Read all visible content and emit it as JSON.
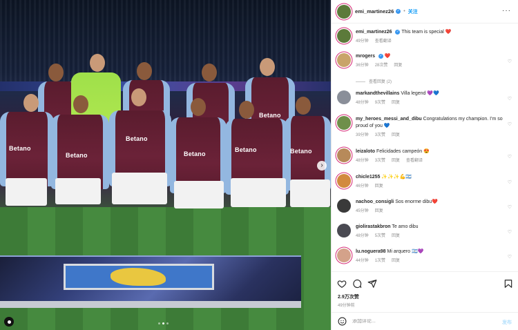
{
  "post": {
    "author": "emi_martinez26",
    "follow_label": "关注",
    "caption": "This team is special",
    "caption_emoji": "❤️",
    "caption_time": "49分钟",
    "caption_action": "查看翻译",
    "slide_count": 3,
    "active_slide": 2,
    "likes": "2.9万次赞",
    "time_ago": "49分钟前",
    "comment_placeholder": "添加评论...",
    "post_label": "发布"
  },
  "photo": {
    "sponsor": "Betano"
  },
  "comments": [
    {
      "user": "mrogers",
      "text": "",
      "emoji": "❤️",
      "verified": true,
      "time": "36分钟",
      "likes": "28次赞",
      "reply": "回复",
      "avatar_color": "#c9a46a",
      "story_ring": true
    },
    {
      "user": "markandthevillains",
      "text": "Villa legend",
      "emoji": "💜💙",
      "verified": false,
      "time": "48分钟",
      "likes": "9次赞",
      "reply": "回复",
      "avatar_color": "#8a8f99",
      "story_ring": false
    },
    {
      "user": "my_heroes_messi_and_dibu",
      "text": "Congratulations my champion. I'm so proud of you",
      "emoji": "💙",
      "verified": false,
      "time": "39分钟",
      "likes": "3次赞",
      "reply": "回复",
      "avatar_color": "#6f8f4a",
      "story_ring": true
    },
    {
      "user": "leizaloto",
      "text": "Felicidades campeón",
      "emoji": "😍",
      "verified": false,
      "time": "48分钟",
      "likes": "3次赞",
      "reply": "回复",
      "action": "查看翻译",
      "avatar_color": "#b78a5a",
      "story_ring": true
    },
    {
      "user": "chicle1255",
      "text": "",
      "emoji": "✨✨✨💪🇦🇷",
      "verified": false,
      "time": "46分钟",
      "likes": "",
      "reply": "回复",
      "avatar_color": "#d28a3f",
      "story_ring": true
    },
    {
      "user": "nachoo_consigli",
      "text": "Sos enorme dibu",
      "emoji": "❤️",
      "verified": false,
      "time": "45分钟",
      "likes": "",
      "reply": "回复",
      "avatar_color": "#3a3a3a",
      "story_ring": false
    },
    {
      "user": "giolirastakbron",
      "text": "Te amo dibu",
      "emoji": "",
      "verified": false,
      "time": "48分钟",
      "likes": "5次赞",
      "reply": "回复",
      "avatar_color": "#4a4a52",
      "story_ring": false
    },
    {
      "user": "lu.noguera98",
      "text": "Mi arquero",
      "emoji": "🇦🇷💜",
      "verified": false,
      "time": "44分钟",
      "likes": "1次赞",
      "reply": "回复",
      "avatar_color": "#d4a28a",
      "story_ring": true
    }
  ],
  "hide_replies_label": "查看回复 (2)",
  "icons": [
    "more-icon",
    "heart-icon",
    "comment-icon",
    "share-icon",
    "save-icon",
    "emoji-icon",
    "next-arrow-icon",
    "tag-icon",
    "verified-icon"
  ]
}
